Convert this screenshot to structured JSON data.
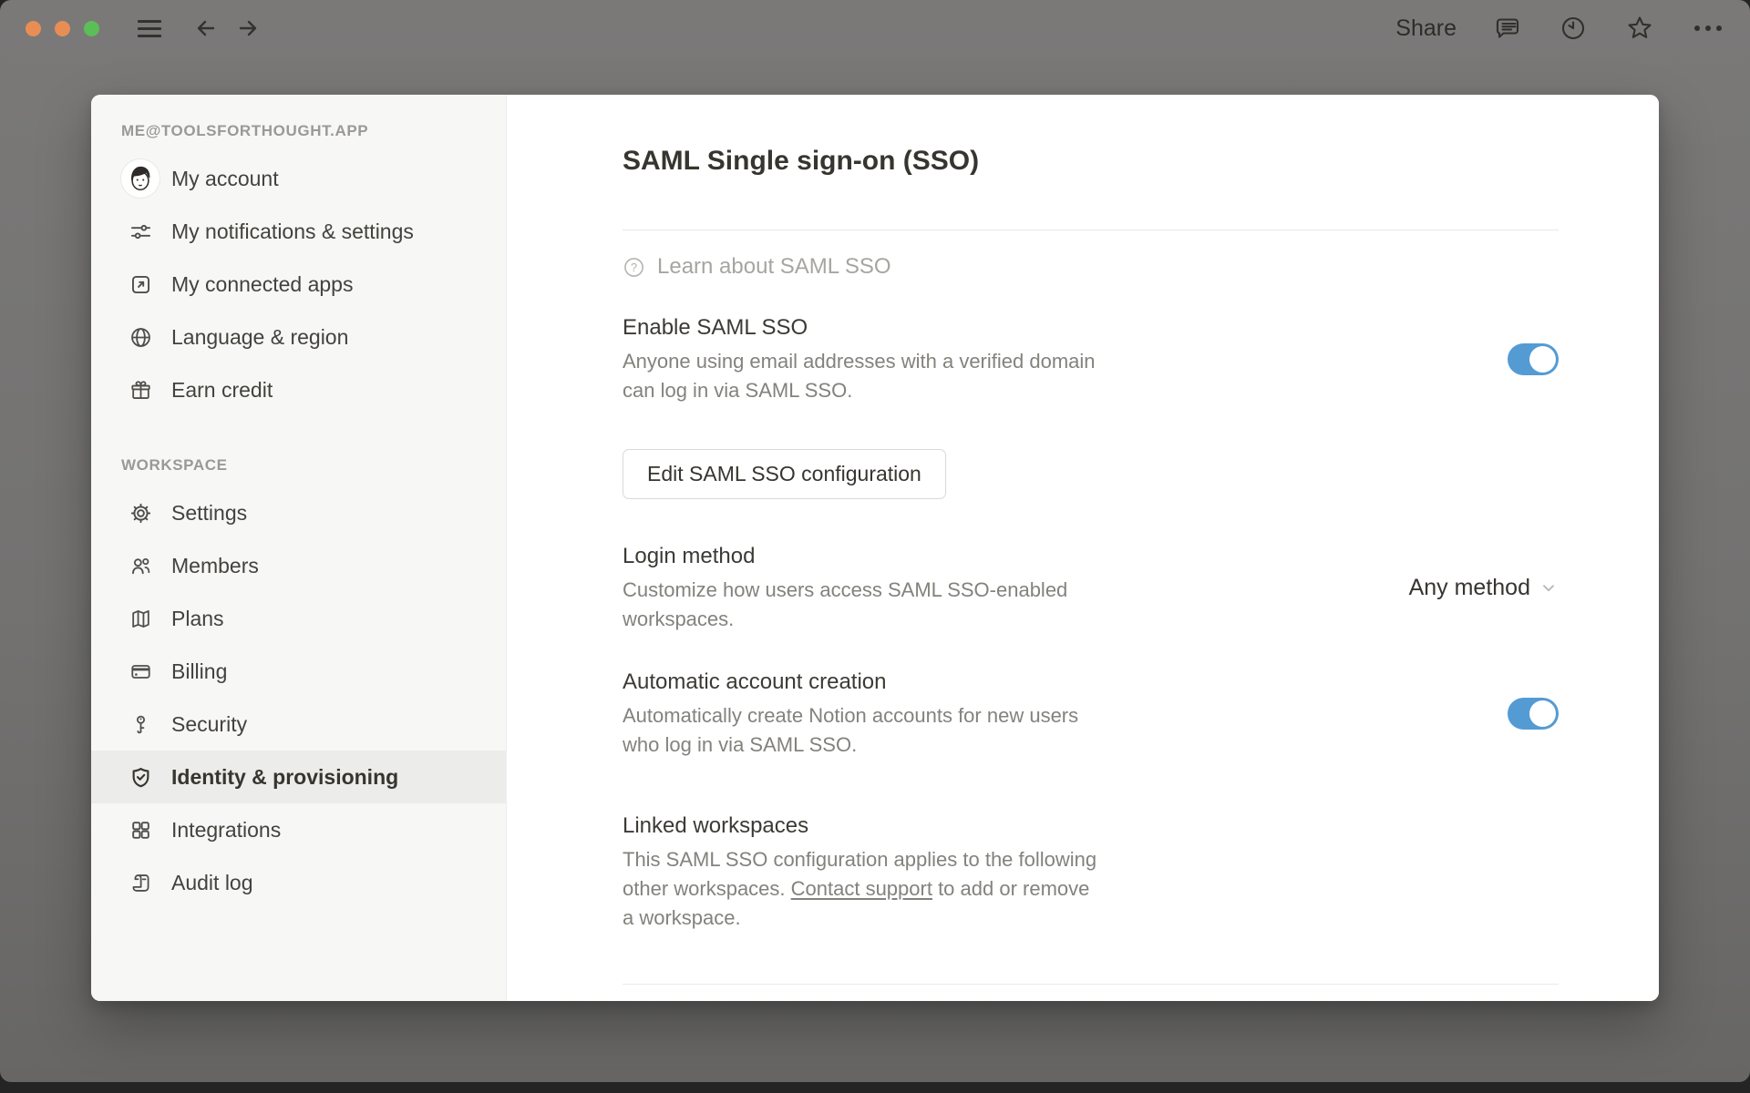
{
  "titlebar": {
    "share_label": "Share"
  },
  "sidebar": {
    "account_header": "ME@TOOLSFORTHOUGHT.APP",
    "account_items": [
      {
        "label": "My account",
        "icon": "avatar"
      },
      {
        "label": "My notifications & settings",
        "icon": "sliders-icon"
      },
      {
        "label": "My connected apps",
        "icon": "external-link-box-icon"
      },
      {
        "label": "Language & region",
        "icon": "globe-icon"
      },
      {
        "label": "Earn credit",
        "icon": "gift-icon"
      }
    ],
    "workspace_header": "WORKSPACE",
    "workspace_items": [
      {
        "label": "Settings",
        "icon": "gear-icon"
      },
      {
        "label": "Members",
        "icon": "people-icon"
      },
      {
        "label": "Plans",
        "icon": "map-icon"
      },
      {
        "label": "Billing",
        "icon": "credit-card-icon"
      },
      {
        "label": "Security",
        "icon": "key-icon"
      },
      {
        "label": "Identity & provisioning",
        "icon": "shield-check-icon",
        "active": true
      },
      {
        "label": "Integrations",
        "icon": "grid-icon"
      },
      {
        "label": "Audit log",
        "icon": "scroll-icon"
      }
    ]
  },
  "main": {
    "title": "SAML Single sign-on (SSO)",
    "learn_link": "Learn about SAML SSO",
    "enable_saml": {
      "title": "Enable SAML SSO",
      "description_line1": "Anyone using email addresses with a verified domain",
      "description_line2": "can log in via SAML SSO.",
      "toggle_state": "on"
    },
    "edit_button_label": "Edit SAML SSO configuration",
    "login_method": {
      "title": "Login method",
      "description_line1": "Customize how users access SAML SSO-enabled",
      "description_line2": "workspaces.",
      "selected_value": "Any method"
    },
    "auto_account": {
      "title": "Automatic account creation",
      "description_line1": "Automatically create Notion accounts for new users",
      "description_line2": "who log in via SAML SSO.",
      "toggle_state": "on"
    },
    "linked_workspaces": {
      "title": "Linked workspaces",
      "line1": "This SAML SSO configuration applies to the following",
      "line2_before": "other workspaces. ",
      "line2_link": "Contact support",
      "line2_after": " to add or remove",
      "line3": "a workspace."
    }
  },
  "colors": {
    "toggle_on": "#549bd4",
    "traffic_light_1": "#e88e55",
    "traffic_light_2": "#e88e55",
    "traffic_light_3": "#5cbe56",
    "sidebar_bg": "#f7f7f5",
    "active_row_bg": "#ececea",
    "text_primary": "#37352f",
    "text_secondary": "#83827d"
  }
}
